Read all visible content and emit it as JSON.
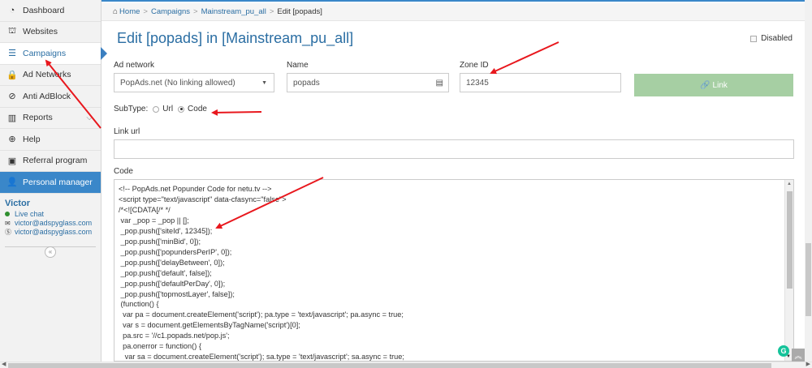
{
  "sidebar": {
    "items": [
      {
        "label": "Dashboard",
        "icon": "dashboard-icon",
        "glyph": "◔"
      },
      {
        "label": "Websites",
        "icon": "sitemap-icon",
        "glyph": "⛫"
      },
      {
        "label": "Campaigns",
        "icon": "sliders-icon",
        "glyph": "☰"
      },
      {
        "label": "Ad Networks",
        "icon": "lock-icon",
        "glyph": "🔒"
      },
      {
        "label": "Anti AdBlock",
        "icon": "ban-icon",
        "glyph": "⊘"
      },
      {
        "label": "Reports",
        "icon": "bar-chart-icon",
        "glyph": "▥"
      },
      {
        "label": "Help",
        "icon": "lifebuoy-icon",
        "glyph": "⊕"
      },
      {
        "label": "Referral program",
        "icon": "money-icon",
        "glyph": "▣"
      },
      {
        "label": "Personal manager",
        "icon": "user-icon",
        "glyph": "👤"
      }
    ],
    "active": "Campaigns",
    "user": {
      "name": "Victor",
      "live_chat": "Live chat",
      "email": "victor@adspyglass.com",
      "skype": "victor@adspyglass.com"
    },
    "collapse_glyph": "«"
  },
  "breadcrumb": {
    "home": "Home",
    "campaigns": "Campaigns",
    "campaign": "Mainstream_pu_all",
    "current": "Edit [popads]",
    "sep": ">"
  },
  "page_title": "Edit [popads] in [Mainstream_pu_all]",
  "disabled_label": "Disabled",
  "form": {
    "ad_network_label": "Ad network",
    "ad_network_value": "PopAds.net (No linking allowed)",
    "name_label": "Name",
    "name_value": "popads",
    "zone_label": "Zone ID",
    "zone_value": "12345",
    "link_button": "Link",
    "subtype_label": "SubType:",
    "subtype_url": "Url",
    "subtype_code": "Code",
    "link_url_label": "Link url",
    "link_url_value": "",
    "code_label": "Code",
    "code_value": "<!-- PopAds.net Popunder Code for netu.tv -->\n<script type=\"text/javascript\" data-cfasync=\"false\">\n/*<![CDATA[/* */\n var _pop = _pop || [];\n _pop.push(['siteId', 12345]);\n _pop.push(['minBid', 0]);\n _pop.push(['popundersPerIP', 0]);\n _pop.push(['delayBetween', 0]);\n _pop.push(['default', false]);\n _pop.push(['defaultPerDay', 0]);\n _pop.push(['topmostLayer', false]);\n (function() {\n  var pa = document.createElement('script'); pa.type = 'text/javascript'; pa.async = true;\n  var s = document.getElementsByTagName('script')[0];\n  pa.src = '//c1.popads.net/pop.js';\n  pa.onerror = function() {\n   var sa = document.createElement('script'); sa.type = 'text/javascript'; sa.async = true;"
  },
  "colors": {
    "accent": "#3a87c9",
    "link_button": "#a6cfa3",
    "annotation": "#e8171d"
  }
}
